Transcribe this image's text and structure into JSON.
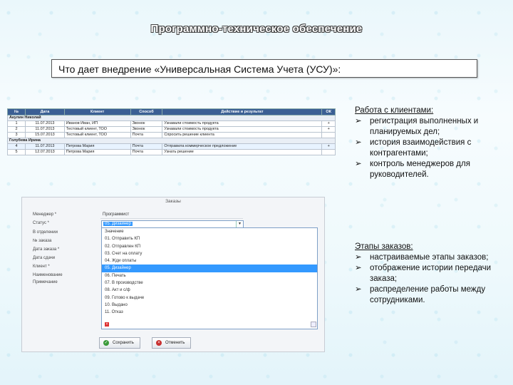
{
  "slide": {
    "title": "Программно-техническое обеспечение",
    "subtitle": "Что дает внедрение «Универсальная Система Учета (УСУ)»:"
  },
  "table": {
    "headers": [
      "№",
      "Дата",
      "Клиент",
      "Способ",
      "Действие и результат",
      "ОК"
    ],
    "groups": [
      {
        "name": "Акулин Николай",
        "rows": [
          [
            "1",
            "11.07.2013",
            "Иванов Иван, ИП",
            "Звонок",
            "Узнавали стоимость продукта",
            "+"
          ],
          [
            "2",
            "11.07.2013",
            "Тестовый клиент, ТОО",
            "Звонок",
            "Узнавали стоимость продукта",
            "+"
          ],
          [
            "3",
            "15.07.2013",
            "Тестовый клиент, ТОО",
            "Почта",
            "Спросить решение клиента",
            ""
          ]
        ]
      },
      {
        "name": "Голубева Ирина",
        "rows": [
          [
            "4",
            "11.07.2013",
            "Петрова Мария",
            "Почта",
            "Отправила коммерческое предложение",
            "+"
          ],
          [
            "5",
            "12.07.2013",
            "Петрова Мария",
            "Почта",
            "Узнать решение",
            ""
          ]
        ]
      }
    ]
  },
  "clients_block": {
    "heading": "Работа с клиентами:",
    "items": [
      "регистрация выполненных и планируемых дел;",
      "история взаимодействия с контрагентами;",
      "контроль менеджеров для руководителей."
    ]
  },
  "orders_block": {
    "heading": "Этапы заказов:",
    "items": [
      "настраиваемые этапы заказов;",
      "отображение истории передачи заказа;",
      "распределение работы между сотрудниками."
    ]
  },
  "dialog": {
    "title": "Заказы",
    "labels": [
      "Менеджер *",
      "Статус *",
      "В отделении",
      "№ заказа",
      "Дата заказа *",
      "Дата сдачи",
      "Клиент *",
      "Наименование",
      "Примечание"
    ],
    "manager_value": "Программист",
    "status_value": "05. Дизайнер",
    "dropdown": {
      "items": [
        "Значение",
        "01. Отправить КП",
        "02. Отправлен КП",
        "03. Счет на оплату",
        "04. Жди оплаты",
        "05. Дизайнер",
        "06. Печать",
        "07. В производстве",
        "08. Акт и с/ф",
        "09. Готово к выдаче",
        "10. Выдано",
        "11. Отказ"
      ],
      "selected_index": 5
    },
    "save_label": "Сохранить",
    "cancel_label": "Отменить"
  },
  "colors": {
    "table_header": "#3b5f94",
    "selection": "#3399ff",
    "save_icon": "#3a9a3a",
    "cancel_icon": "#c83030"
  }
}
